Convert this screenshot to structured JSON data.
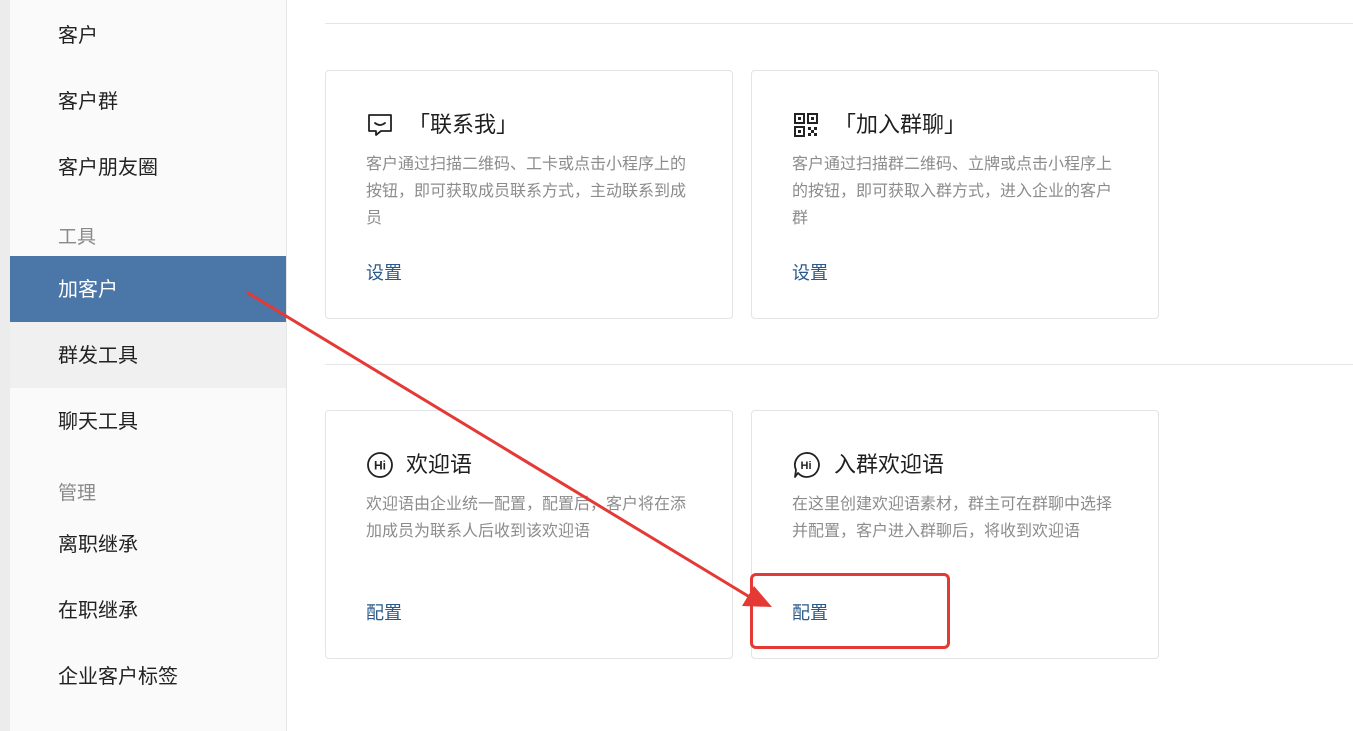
{
  "sidebar": {
    "items": [
      {
        "label": "客户"
      },
      {
        "label": "客户群"
      },
      {
        "label": "客户朋友圈"
      }
    ],
    "section_tools": "工具",
    "tools": [
      {
        "label": "加客户"
      },
      {
        "label": "群发工具"
      },
      {
        "label": "聊天工具"
      }
    ],
    "section_manage": "管理",
    "manage": [
      {
        "label": "离职继承"
      },
      {
        "label": "在职继承"
      },
      {
        "label": "企业客户标签"
      }
    ]
  },
  "cards": [
    {
      "icon": "chat-bubble-icon",
      "title": "「联系我」",
      "desc": "客户通过扫描二维码、工卡或点击小程序上的按钮，即可获取成员联系方式，主动联系到成员",
      "link": "设置"
    },
    {
      "icon": "qr-code-icon",
      "title": "「加入群聊」",
      "desc": "客户通过扫描群二维码、立牌或点击小程序上的按钮，即可获取入群方式，进入企业的客户群",
      "link": "设置"
    },
    {
      "icon": "hi-circle-icon",
      "title": "欢迎语",
      "desc": "欢迎语由企业统一配置，配置后，客户将在添加成员为联系人后收到该欢迎语",
      "link": "配置"
    },
    {
      "icon": "hi-bubble-icon",
      "title": "入群欢迎语",
      "desc": "在这里创建欢迎语素材，群主可在群聊中选择并配置，客户进入群聊后，将收到欢迎语",
      "link": "配置"
    }
  ],
  "colors": {
    "active_bg": "#4a76a8",
    "link": "#2b5a8a",
    "annotation": "#e53935"
  }
}
